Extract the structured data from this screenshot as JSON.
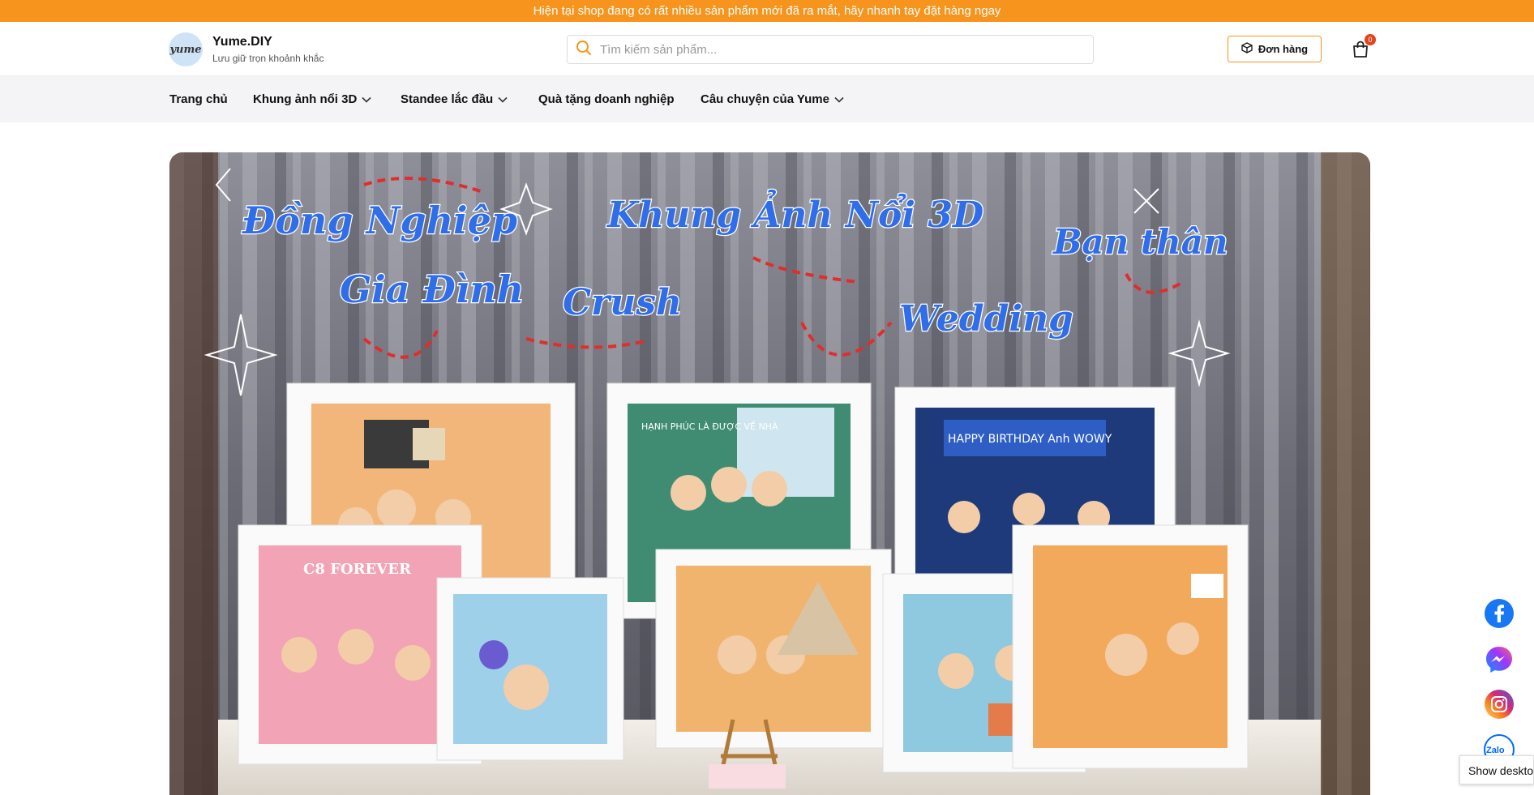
{
  "announcement": "Hiện tại shop đang có rất nhiều sản phẩm mới đã ra mắt, hãy nhanh tay đặt hàng ngay",
  "brand": {
    "logo_text": "yume",
    "name": "Yume.DIY",
    "tagline": "Lưu giữ trọn khoảnh khắc"
  },
  "search": {
    "placeholder": "Tìm kiếm sản phẩm...",
    "icon": "search-icon"
  },
  "header": {
    "orders_label": "Đơn hàng",
    "cart_count": "0"
  },
  "nav": {
    "items": [
      {
        "label": "Trang chủ",
        "has_dropdown": false
      },
      {
        "label": "Khung ảnh nổi 3D",
        "has_dropdown": true
      },
      {
        "label": "Standee lắc đầu",
        "has_dropdown": true
      },
      {
        "label": "Quà tặng doanh nghiệp",
        "has_dropdown": false
      },
      {
        "label": "Câu chuyện của Yume",
        "has_dropdown": true
      }
    ]
  },
  "hero": {
    "texts": {
      "t1": "Đồng Nghiệp",
      "t2": "Khung Ảnh Nổi 3D",
      "t3": "Bạn thân",
      "t4": "Gia Đình",
      "t5": "Crush",
      "t6": "Wedding"
    },
    "frame_texts": {
      "f1": "HẠNH PHÚC LÀ ĐƯỢC VỀ NHÀ",
      "f2": "HAPPY BIRTHDAY Anh WOWY",
      "f3": "C8 FOREVER"
    }
  },
  "social": {
    "facebook": "facebook-icon",
    "messenger": "messenger-icon",
    "instagram": "instagram-icon",
    "zalo_label": "Zalo"
  },
  "tooltip": "Show deskto",
  "colors": {
    "accent": "#f7941d",
    "badge": "#e8421c",
    "facebook": "#1877f2"
  }
}
